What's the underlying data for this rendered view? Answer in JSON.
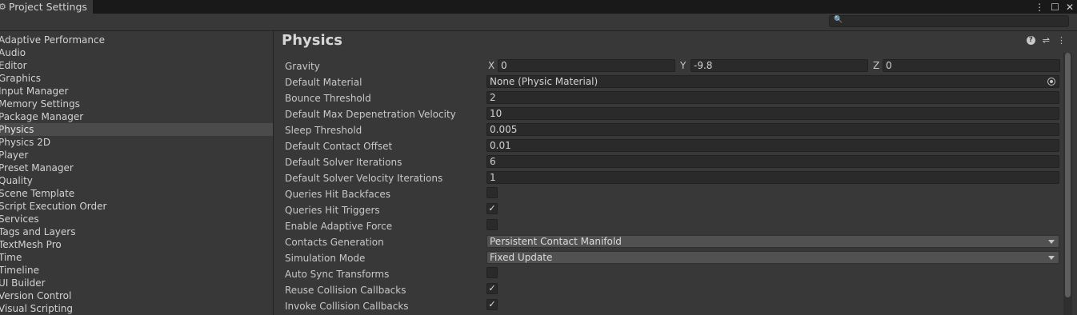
{
  "window": {
    "tab_title": "Project Settings",
    "tab_icon": "gear-icon",
    "controls": [
      "kebab-menu-icon",
      "maximize-icon",
      "close-icon"
    ]
  },
  "search": {
    "placeholder": "",
    "icon": "search-icon"
  },
  "sidebar": {
    "items": [
      "Adaptive Performance",
      "Audio",
      "Editor",
      "Graphics",
      "Input Manager",
      "Memory Settings",
      "Package Manager",
      "Physics",
      "Physics 2D",
      "Player",
      "Preset Manager",
      "Quality",
      "Scene Template",
      "Script Execution Order",
      "Services",
      "Tags and Layers",
      "TextMesh Pro",
      "Time",
      "Timeline",
      "UI Builder",
      "Version Control",
      "Visual Scripting"
    ],
    "selected": "Physics"
  },
  "main": {
    "title": "Physics",
    "header_icons": [
      "help-icon",
      "presets-icon",
      "kebab-menu-icon"
    ],
    "gravity": {
      "label": "Gravity",
      "x_label": "X",
      "x": "0",
      "y_label": "Y",
      "y": "-9.8",
      "z_label": "Z",
      "z": "0"
    },
    "default_material": {
      "label": "Default Material",
      "value": "None (Physic Material)"
    },
    "bounce_threshold": {
      "label": "Bounce Threshold",
      "value": "2"
    },
    "max_depenetration": {
      "label": "Default Max Depenetration Velocity",
      "value": "10"
    },
    "sleep_threshold": {
      "label": "Sleep Threshold",
      "value": "0.005"
    },
    "contact_offset": {
      "label": "Default Contact Offset",
      "value": "0.01"
    },
    "solver_iterations": {
      "label": "Default Solver Iterations",
      "value": "6"
    },
    "solver_velocity_iterations": {
      "label": "Default Solver Velocity Iterations",
      "value": "1"
    },
    "queries_hit_backfaces": {
      "label": "Queries Hit Backfaces",
      "checked": false,
      "mark": ""
    },
    "queries_hit_triggers": {
      "label": "Queries Hit Triggers",
      "checked": true,
      "mark": "✓"
    },
    "enable_adaptive_force": {
      "label": "Enable Adaptive Force",
      "checked": false,
      "mark": ""
    },
    "contacts_generation": {
      "label": "Contacts Generation",
      "value": "Persistent Contact Manifold"
    },
    "simulation_mode": {
      "label": "Simulation Mode",
      "value": "Fixed Update"
    },
    "auto_sync_transforms": {
      "label": "Auto Sync Transforms",
      "checked": false,
      "mark": ""
    },
    "reuse_collision_callbacks": {
      "label": "Reuse Collision Callbacks",
      "checked": true,
      "mark": "✓"
    },
    "invoke_collision_callbacks": {
      "label": "Invoke Collision Callbacks",
      "checked": true,
      "mark": "✓"
    }
  }
}
